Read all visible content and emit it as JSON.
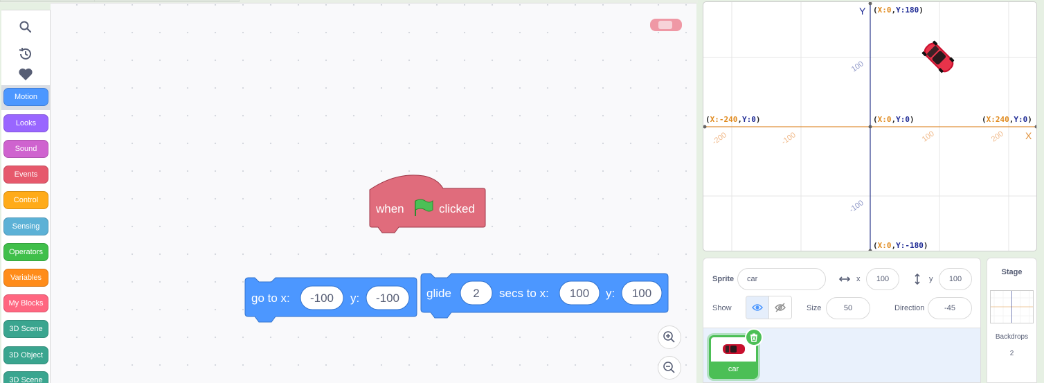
{
  "palette": {
    "categories": [
      {
        "label": "Motion",
        "color": "#4c97ff"
      },
      {
        "label": "Looks",
        "color": "#9966ff"
      },
      {
        "label": "Sound",
        "color": "#cf63cf"
      },
      {
        "label": "Events",
        "color": "#e6596c"
      },
      {
        "label": "Control",
        "color": "#ffab19"
      },
      {
        "label": "Sensing",
        "color": "#5cb1d6"
      },
      {
        "label": "Operators",
        "color": "#40bf4a"
      },
      {
        "label": "Variables",
        "color": "#ff8c1a"
      },
      {
        "label": "My Blocks",
        "color": "#ff6680"
      },
      {
        "label": "3D Scene",
        "color": "#3aa58f"
      },
      {
        "label": "3D Object",
        "color": "#3aa58f"
      },
      {
        "label": "3D Scene",
        "color": "#3aa58f"
      }
    ],
    "selected": "Motion"
  },
  "code": {
    "hat_block": {
      "before_flag": "when",
      "after_flag": "clicked",
      "color": "#e06c7c"
    },
    "goto_block": {
      "label1": "go to x:",
      "x_value": "-100",
      "label2": "y:",
      "y_value": "-100",
      "color": "#4c97ff"
    },
    "glide_block": {
      "label1": "glide",
      "secs_value": "2",
      "label2": "secs to x:",
      "x_value": "100",
      "label3": "y:",
      "y_value": "100",
      "color": "#4c97ff"
    }
  },
  "stage": {
    "axis_y": "Y",
    "axis_x": "X",
    "labels": {
      "top": [
        "(",
        "X:0",
        ",",
        "Y:180",
        ")"
      ],
      "bottom": [
        "(",
        "X:0",
        ",",
        "Y:-180",
        ")"
      ],
      "left": [
        "(",
        "X:-240",
        ",",
        "Y:0",
        ")"
      ],
      "right": [
        "(",
        "X:240",
        ",",
        "Y:0",
        ")"
      ],
      "center": [
        "(",
        "X:0",
        ",",
        "Y:0",
        ")"
      ]
    },
    "ticks_x": [
      "-200",
      "-100",
      "100",
      "200"
    ],
    "ticks_y": [
      "100",
      "-100"
    ],
    "colors": {
      "x_axis": "#e0913a",
      "y_axis": "#2c3a8c",
      "coord_x": "#e08a1e",
      "coord_y": "#1f2b95"
    }
  },
  "sprite_info": {
    "sprite_label": "Sprite",
    "sprite_name": "car",
    "x_label": "x",
    "x_value": "100",
    "y_label": "y",
    "y_value": "100",
    "show_label": "Show",
    "size_label": "Size",
    "size_value": "50",
    "direction_label": "Direction",
    "direction_value": "-45"
  },
  "sprites": [
    {
      "name": "car"
    }
  ],
  "stage_selector": {
    "title": "Stage",
    "backdrops_label": "Backdrops",
    "backdrops_count": "2"
  }
}
